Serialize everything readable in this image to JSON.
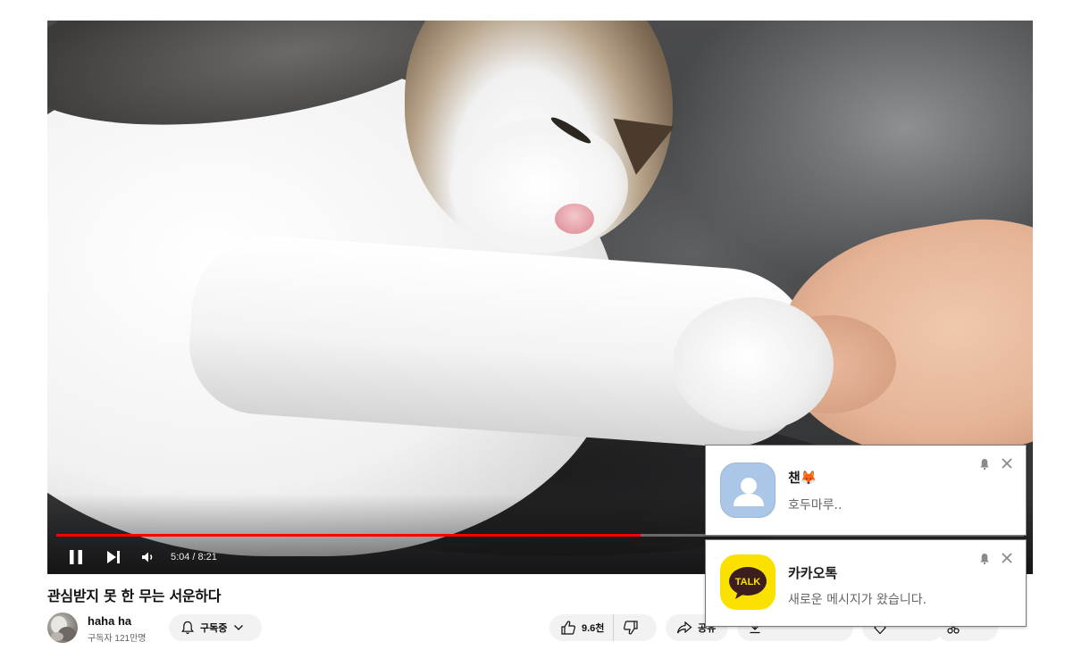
{
  "video": {
    "current_time": "5:04",
    "separator": "/",
    "duration": "8:21",
    "progress": 0.604,
    "progress_color": "#ff0000"
  },
  "title": "관심받지 못 한 무는 서운하다",
  "channel": {
    "name": "haha ha",
    "subscribers": "구독자 121만명",
    "subscribe_label": "구독중"
  },
  "actions": {
    "likes": "9.6천",
    "share_label": "공유"
  },
  "notifications": [
    {
      "sender": "챈🦊",
      "message": "호두마루..",
      "icon": "default-profile-icon"
    },
    {
      "sender": "카카오톡",
      "message": "새로운 메시지가 왔습니다.",
      "icon": "kakaotalk-logo-icon",
      "icon_text": "TALK",
      "icon_color": "#fae100"
    }
  ]
}
